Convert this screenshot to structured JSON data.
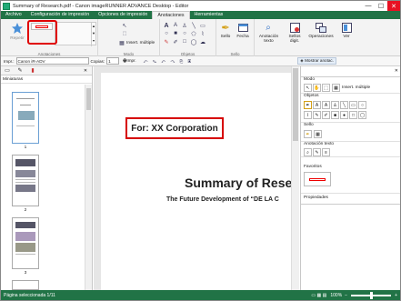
{
  "window": {
    "title": "Summary of Research.pdf - Canon imageRUNNER ADVANCE Desktop - Editor",
    "minimize": "—",
    "maximize": "☐",
    "close": "✕"
  },
  "tabs": [
    "Archivo",
    "Configuración de impresión",
    "Opciones de impresión",
    "Anotaciones",
    "Herramientas"
  ],
  "ribbon": {
    "repeat_label": "Repetir",
    "annotations_group": "Anotaciones",
    "mode_group": "Modo",
    "insert_multiple": "Insert. múltiple",
    "objects_group": "Objetos",
    "stamp_label": "Sello",
    "date_label": "Fecha",
    "stamp_group": "Sello",
    "text_annotation_label": "Anotación texto",
    "digital_stamp_label": "Sellos digit.",
    "operations_label": "Operaciones",
    "view_label": "Ver"
  },
  "toolbar": {
    "printer_label": "Impr.:",
    "printer_value": "Canon iR-ADV",
    "copies_label": "Copias:",
    "copies_value": "1",
    "print_label": "Impr.",
    "show_annotations": "Mostrar anotac."
  },
  "leftpane": {
    "label": "Miniaturas",
    "pages": [
      "1",
      "2",
      "3"
    ]
  },
  "document": {
    "stamp_text": "For: XX Corporation",
    "title": "Summary of Rese",
    "subtitle": "The Future Development of “DE LA C"
  },
  "rightpane": {
    "mode_label": "Modo",
    "insert_multiple": "Insert. múltiple",
    "objects_label": "Objetos",
    "stamp_label": "Sello",
    "text_annotation_label": "Anotación texto",
    "favorites_label": "Favoritos",
    "properties_label": "Propiedades"
  },
  "status": {
    "selected_page": "Página seleccionada 1/11",
    "zoom": "100%"
  },
  "colors": {
    "accent": "#217346",
    "highlight_red": "#e00000"
  }
}
